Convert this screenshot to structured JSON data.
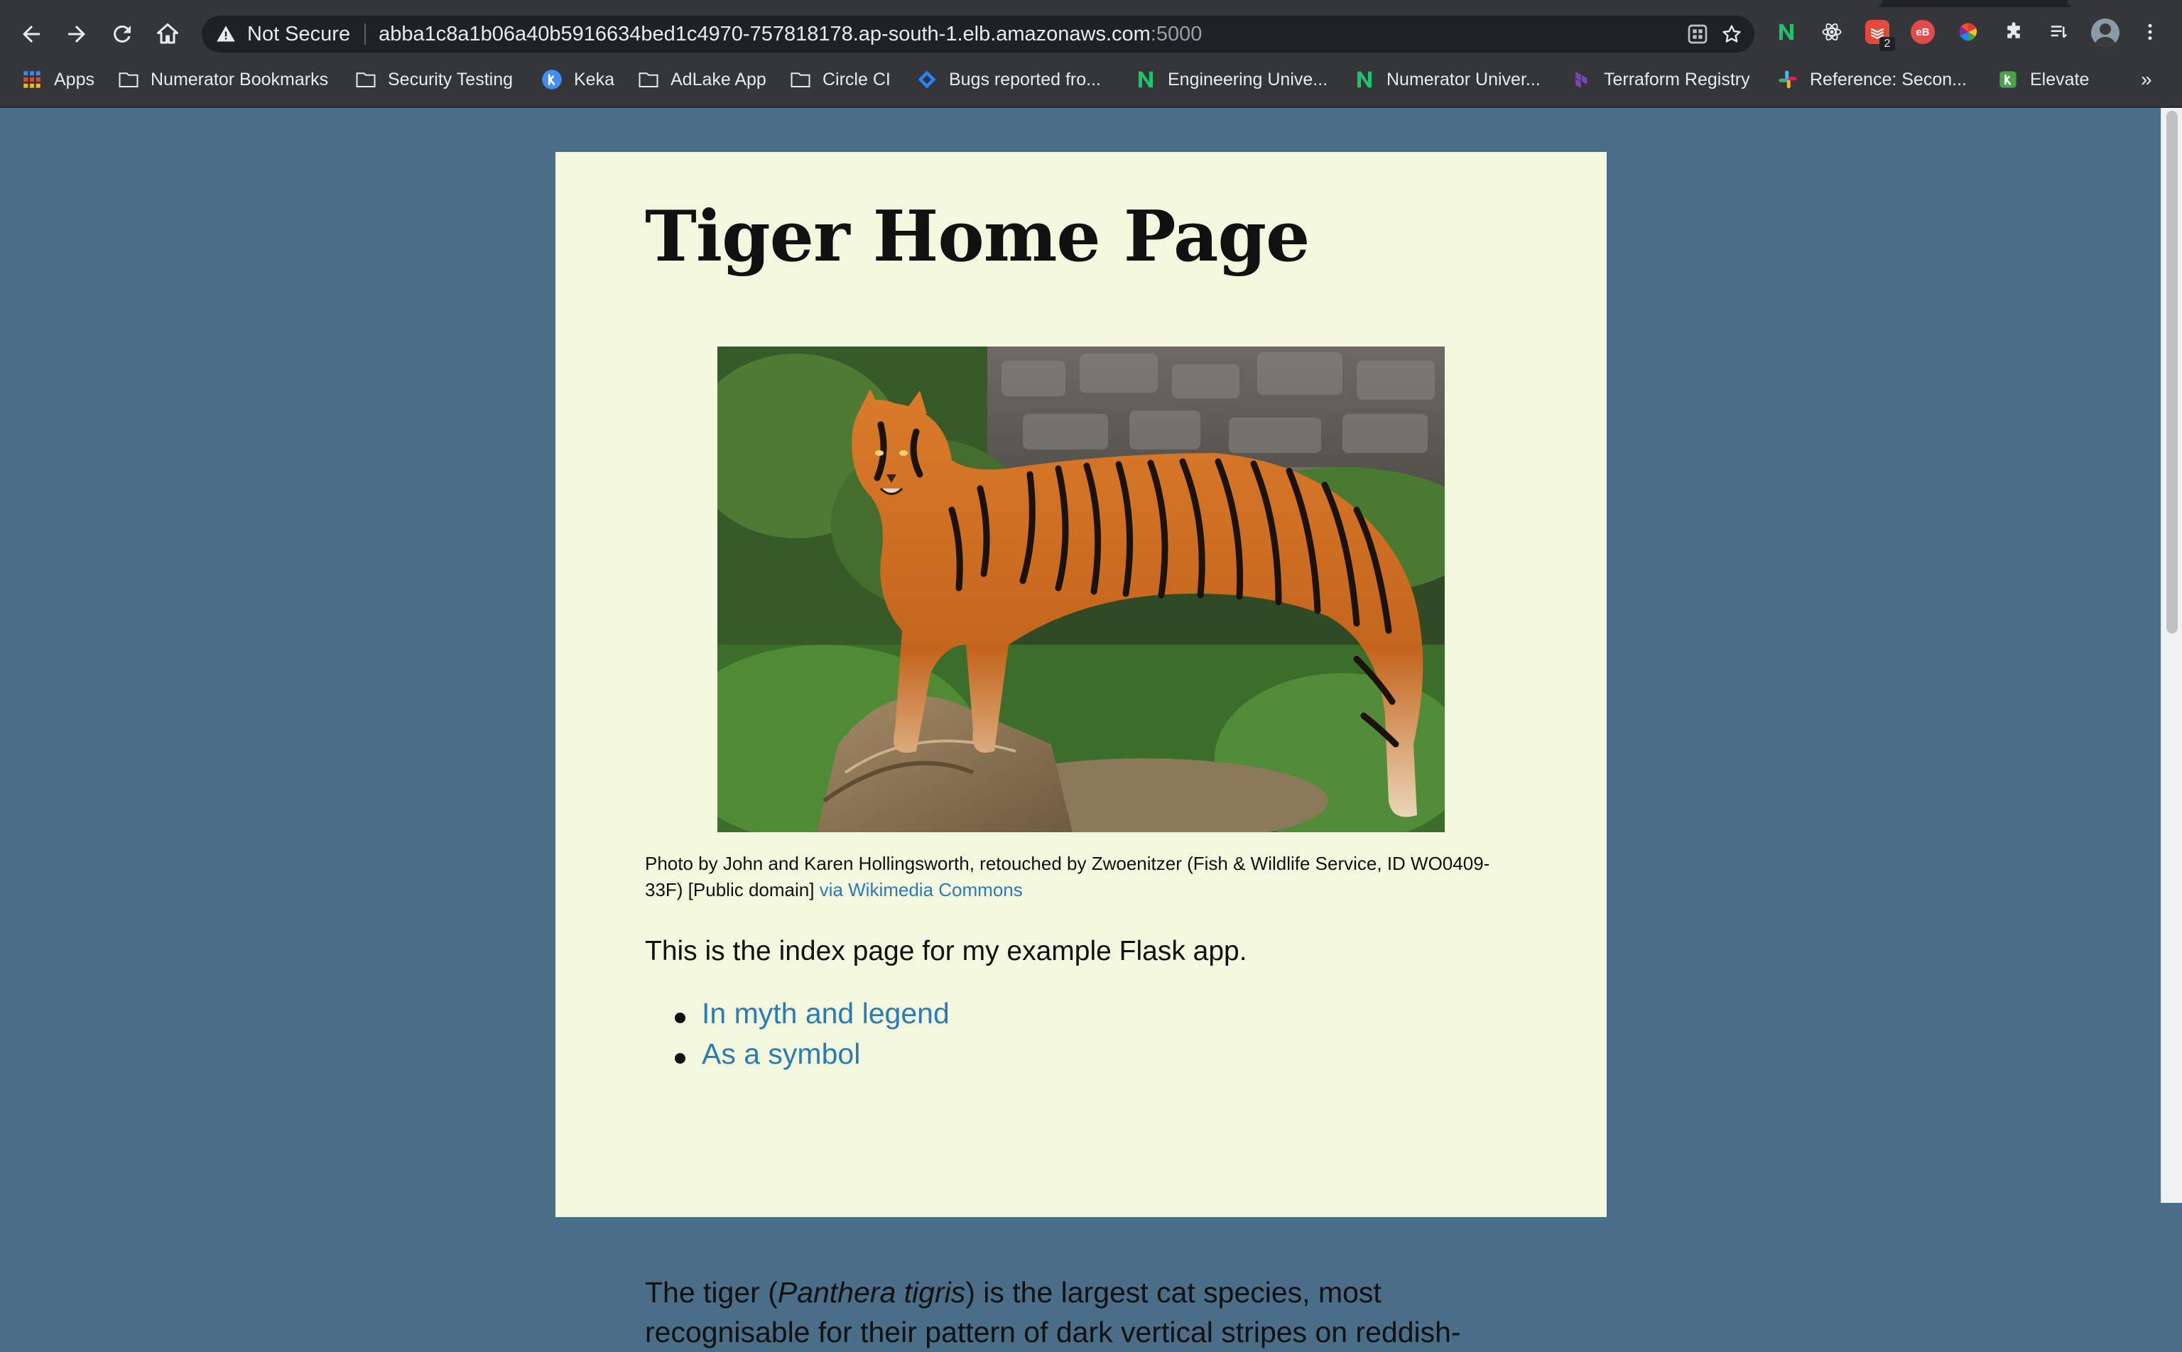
{
  "browser": {
    "security_label": "Not Secure",
    "url_host": "abba1c8a1b06a40b5916634bed1c4970-757818178.ap-south-1.elb.amazonaws.com",
    "url_port": ":5000",
    "extension_badge": "2",
    "extension_eb_label": "eB"
  },
  "bookmarks": {
    "apps": "Apps",
    "items": [
      "Numerator Bookmarks",
      "Security Testing",
      "Keka",
      "AdLake App",
      "Circle CI",
      "Bugs reported fro...",
      "Engineering Unive...",
      "Numerator Univer...",
      "Terraform Registry",
      "Reference: Secon...",
      "Elevate"
    ],
    "overflow": "»"
  },
  "page": {
    "title": "Tiger Home Page",
    "caption_text": "Photo by John and Karen Hollingsworth, retouched by Zwoenitzer (Fish & Wildlife Service, ID WO0409-33F) [Public domain] ",
    "caption_link": "via Wikimedia Commons",
    "intro": "This is the index page for my example Flask app.",
    "links": [
      "In myth and legend",
      "As a symbol"
    ],
    "para_before": "The tiger (",
    "para_italic": "Panthera tigris",
    "para_after": ") is the largest cat species, most recognisable for their pattern of dark vertical stripes on reddish-"
  },
  "colors": {
    "page_bg": "#4a6e87",
    "card_bg": "#f3f7de",
    "link": "#2b7bb5",
    "chrome_bg": "#35363a"
  }
}
